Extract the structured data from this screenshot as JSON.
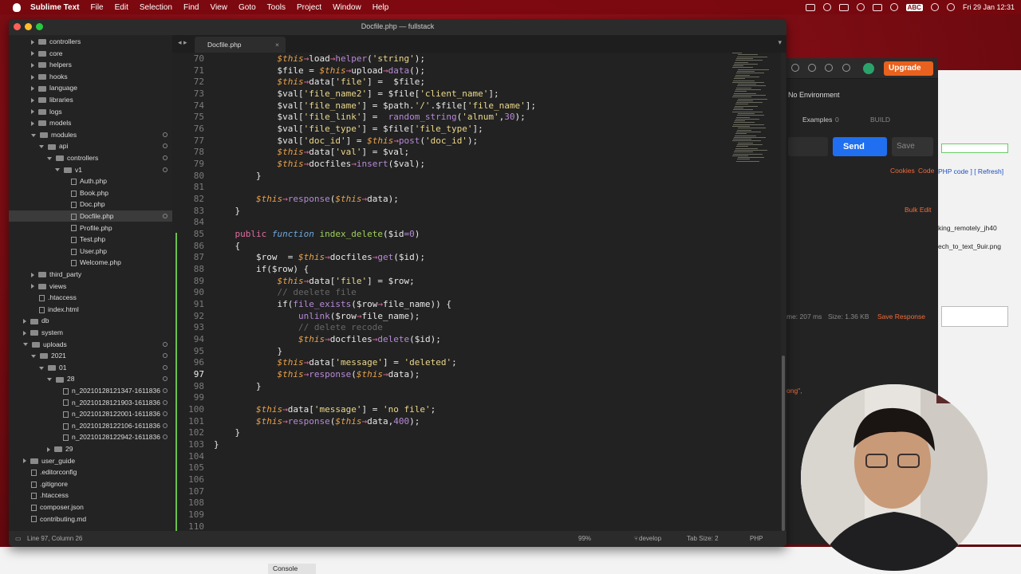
{
  "menubar": {
    "app": "Sublime Text",
    "items": [
      "File",
      "Edit",
      "Selection",
      "Find",
      "View",
      "Goto",
      "Tools",
      "Project",
      "Window",
      "Help"
    ],
    "input_source": "ABC",
    "clock": "Fri 29 Jan  12:31"
  },
  "window": {
    "title": "Docfile.php — fullstack",
    "tab": "Docfile.php"
  },
  "sidebar": [
    {
      "label": "controllers",
      "indent": 0,
      "kind": "folder",
      "open": false
    },
    {
      "label": "core",
      "indent": 0,
      "kind": "folder",
      "open": false
    },
    {
      "label": "helpers",
      "indent": 0,
      "kind": "folder",
      "open": false
    },
    {
      "label": "hooks",
      "indent": 0,
      "kind": "folder",
      "open": false
    },
    {
      "label": "language",
      "indent": 0,
      "kind": "folder",
      "open": false
    },
    {
      "label": "libraries",
      "indent": 0,
      "kind": "folder",
      "open": false
    },
    {
      "label": "logs",
      "indent": 0,
      "kind": "folder",
      "open": false
    },
    {
      "label": "models",
      "indent": 0,
      "kind": "folder",
      "open": false
    },
    {
      "label": "modules",
      "indent": 0,
      "kind": "folder",
      "open": true
    },
    {
      "label": "api",
      "indent": 1,
      "kind": "folder",
      "open": true
    },
    {
      "label": "controllers",
      "indent": 2,
      "kind": "folder",
      "open": true
    },
    {
      "label": "v1",
      "indent": 3,
      "kind": "folder",
      "open": true
    },
    {
      "label": "Auth.php",
      "indent": 4,
      "kind": "file"
    },
    {
      "label": "Book.php",
      "indent": 4,
      "kind": "file"
    },
    {
      "label": "Doc.php",
      "indent": 4,
      "kind": "file"
    },
    {
      "label": "Docfile.php",
      "indent": 4,
      "kind": "file",
      "selected": true
    },
    {
      "label": "Profile.php",
      "indent": 4,
      "kind": "file"
    },
    {
      "label": "Test.php",
      "indent": 4,
      "kind": "file"
    },
    {
      "label": "User.php",
      "indent": 4,
      "kind": "file"
    },
    {
      "label": "Welcome.php",
      "indent": 4,
      "kind": "file"
    },
    {
      "label": "third_party",
      "indent": 0,
      "kind": "folder",
      "open": false
    },
    {
      "label": "views",
      "indent": 0,
      "kind": "folder",
      "open": false
    },
    {
      "label": ".htaccess",
      "indent": 0,
      "kind": "file"
    },
    {
      "label": "index.html",
      "indent": 0,
      "kind": "file"
    },
    {
      "label": "db",
      "indent": -1,
      "kind": "folder",
      "open": false
    },
    {
      "label": "system",
      "indent": -1,
      "kind": "folder",
      "open": false
    },
    {
      "label": "uploads",
      "indent": -1,
      "kind": "folder",
      "open": true
    },
    {
      "label": "2021",
      "indent": 0,
      "kind": "folder",
      "open": true
    },
    {
      "label": "01",
      "indent": 1,
      "kind": "folder",
      "open": true
    },
    {
      "label": "28",
      "indent": 2,
      "kind": "folder",
      "open": true
    },
    {
      "label": "n_20210128121347-1611836",
      "indent": 3,
      "kind": "file"
    },
    {
      "label": "n_20210128121903-1611836",
      "indent": 3,
      "kind": "file"
    },
    {
      "label": "n_20210128122001-1611836",
      "indent": 3,
      "kind": "file"
    },
    {
      "label": "n_20210128122106-1611836",
      "indent": 3,
      "kind": "file"
    },
    {
      "label": "n_20210128122942-1611836",
      "indent": 3,
      "kind": "file"
    },
    {
      "label": "29",
      "indent": 2,
      "kind": "folder",
      "open": false
    },
    {
      "label": "user_guide",
      "indent": -1,
      "kind": "folder",
      "open": false
    },
    {
      "label": ".editorconfig",
      "indent": -1,
      "kind": "file"
    },
    {
      "label": ".gitignore",
      "indent": -1,
      "kind": "file"
    },
    {
      "label": ".htaccess",
      "indent": -1,
      "kind": "file"
    },
    {
      "label": "composer.json",
      "indent": -1,
      "kind": "file"
    },
    {
      "label": "contributing.md",
      "indent": -1,
      "kind": "file"
    }
  ],
  "code": {
    "first_line": 70,
    "current_line": 97,
    "lines": [
      "            $this→load→helper('string');",
      "            $file = $this→upload→data();",
      "            $this→data['file'] =  $file;",
      "            $val['file_name2'] = $file['client_name'];",
      "            $val['file_name'] = $path.'/'.$file['file_name'];",
      "            $val['file_link'] =  random_string('alnum',30);",
      "            $val['file_type'] = $file['file_type'];",
      "            $val['doc_id'] = $this→post('doc_id');",
      "            $this→data['val'] = $val;",
      "            $this→docfiles→insert($val);",
      "        }",
      "",
      "        $this→response($this→data);",
      "    }",
      "",
      "    public function index_delete($id=0)",
      "    {",
      "        $row  = $this→docfiles→get($id);",
      "        if($row) {",
      "            $this→data['file'] = $row;",
      "            // deelete file",
      "            if(file_exists($row→file_name)) {",
      "                unlink($row→file_name);",
      "                // delete recode",
      "                $this→docfiles→delete($id);",
      "            }",
      "            $this→data['message'] = 'deleted';",
      "            $this→response($this→data);",
      "        }",
      "",
      "        $this→data['message'] = 'no file';",
      "        $this→response($this→data,400);",
      "    }",
      "}",
      "",
      "",
      "",
      "",
      "",
      "",
      ""
    ]
  },
  "status": {
    "position": "Line 97, Column 26",
    "zoom": "99%",
    "branch": "develop",
    "tab_size": "Tab Size: 2",
    "syntax": "PHP"
  },
  "postman": {
    "upgrade": "Upgrade",
    "environment": "No Environment",
    "examples": "Examples",
    "examples_count": "0",
    "build": "BUILD",
    "send": "Send",
    "save": "Save",
    "cookies": "Cookies",
    "code": "Code",
    "bulk_edit": "Bulk Edit",
    "time": "me: 207 ms",
    "size": "Size: 1.36 KB",
    "save_response": "Save Response",
    "snippet": "ong\",",
    "php_code": "PHP code ] [ Refresh]",
    "file1": "king_remotely_jh40",
    "file2": "ech_to_text_9uir.png"
  },
  "console": "Console",
  "colors": {
    "accent": "#1f6ff0",
    "upgrade": "#e8611e",
    "keyword": "#e06c9f",
    "string": "#ecd88a",
    "this": "#e8a14b"
  }
}
